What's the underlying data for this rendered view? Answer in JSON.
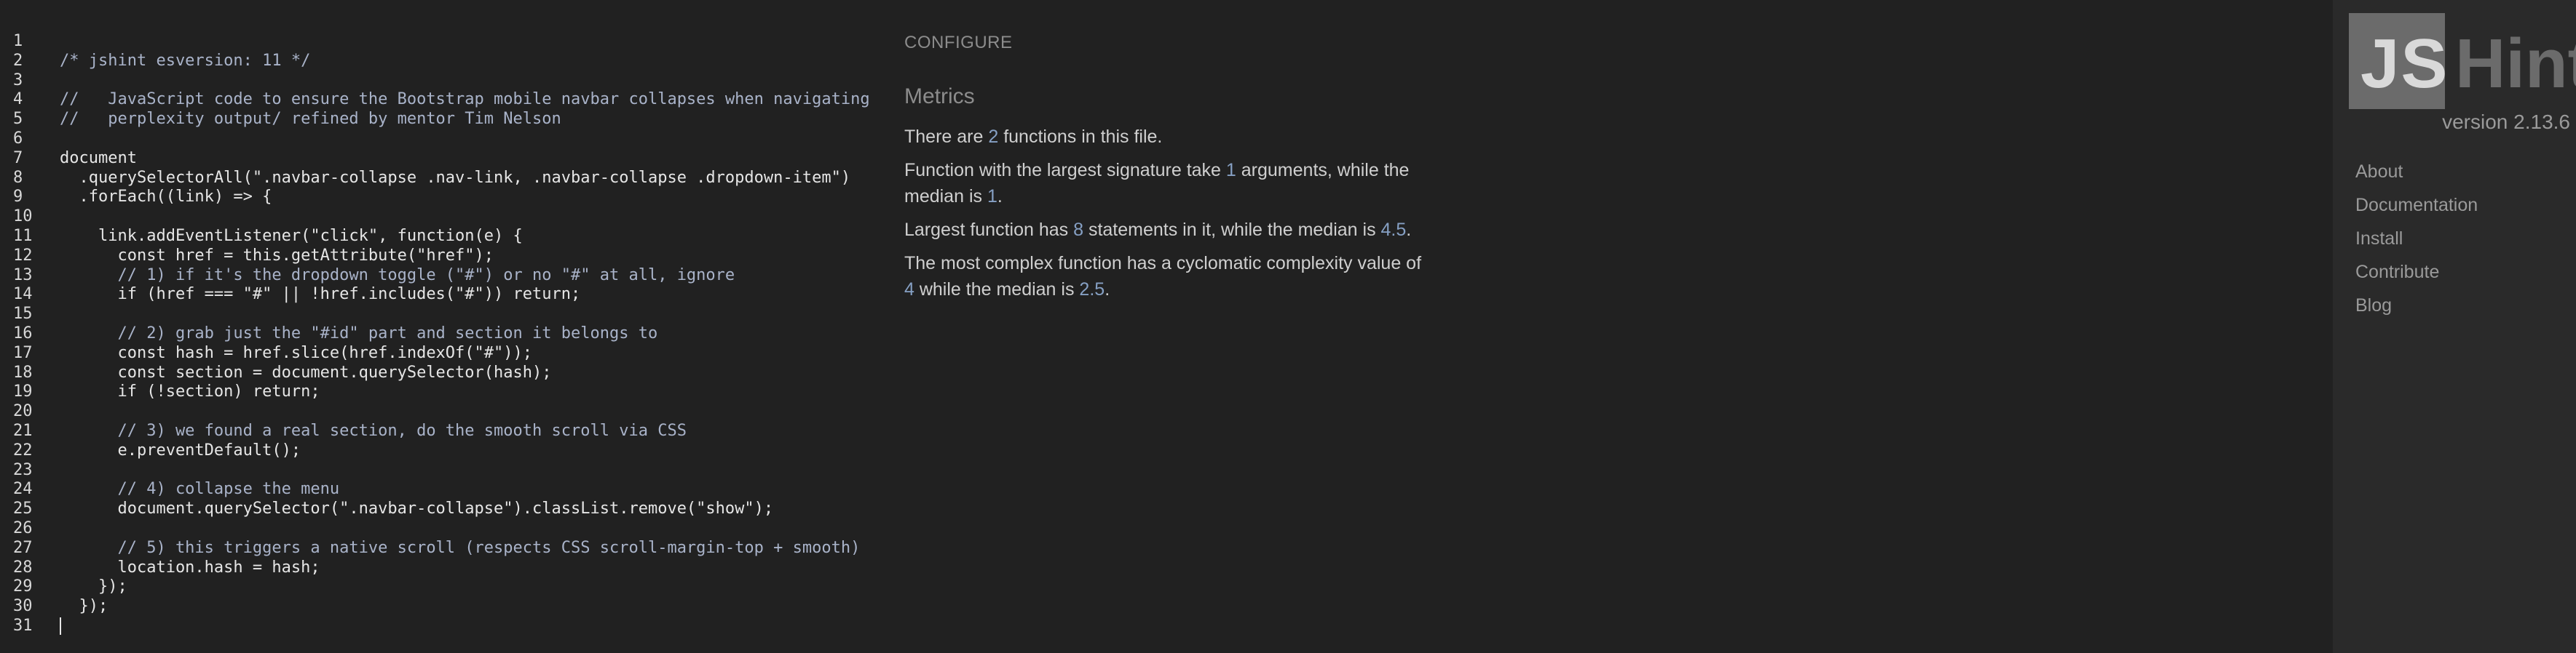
{
  "editor": {
    "line_numbers": [
      "1",
      "2",
      "3",
      "4",
      "5",
      "6",
      "7",
      "8",
      "9",
      "10",
      "11",
      "12",
      "13",
      "14",
      "15",
      "16",
      "17",
      "18",
      "19",
      "20",
      "21",
      "22",
      "23",
      "24",
      "25",
      "26",
      "27",
      "28",
      "29",
      "30",
      "31"
    ],
    "lines": [
      "",
      "/* jshint esversion: 11 */",
      "",
      "//   JavaScript code to ensure the Bootstrap mobile navbar collapses when navigating",
      "//   perplexity output/ refined by mentor Tim Nelson",
      "",
      "document",
      "  .querySelectorAll(\".navbar-collapse .nav-link, .navbar-collapse .dropdown-item\")",
      "  .forEach((link) => {",
      "",
      "    link.addEventListener(\"click\", function(e) {",
      "      const href = this.getAttribute(\"href\");",
      "      // 1) if it's the dropdown toggle (\"#\") or no \"#\" at all, ignore",
      "      if (href === \"#\" || !href.includes(\"#\")) return;",
      "",
      "      // 2) grab just the \"#id\" part and section it belongs to",
      "      const hash = href.slice(href.indexOf(\"#\"));",
      "      const section = document.querySelector(hash);",
      "      if (!section) return;",
      "",
      "      // 3) we found a real section, do the smooth scroll via CSS",
      "      e.preventDefault();",
      "",
      "      // 4) collapse the menu",
      "      document.querySelector(\".navbar-collapse\").classList.remove(\"show\");",
      "",
      "      // 5) this triggers a native scroll (respects CSS scroll-margin-top + smooth)",
      "      location.hash = hash;",
      "    });",
      "  });",
      ""
    ]
  },
  "report": {
    "configure_label": "CONFIGURE",
    "metrics_title": "Metrics",
    "m1_a": "There are ",
    "m1_n": "2",
    "m1_b": " functions in this file.",
    "m2_a": "Function with the largest signature take ",
    "m2_n1": "1",
    "m2_b": " arguments, while the median is ",
    "m2_n2": "1",
    "m2_c": ".",
    "m3_a": "Largest function has ",
    "m3_n1": "8",
    "m3_b": " statements in it, while the median is ",
    "m3_n2": "4.5",
    "m3_c": ".",
    "m4_a": "The most complex function has a cyclomatic complexity value of ",
    "m4_n1": "4",
    "m4_b": " while the median is ",
    "m4_n2": "2.5",
    "m4_c": "."
  },
  "sidebar": {
    "logo_js": "JS",
    "logo_hint": "Hint",
    "version": "version 2.13.6",
    "nav": [
      "About",
      "Documentation",
      "Install",
      "Contribute",
      "Blog"
    ]
  },
  "colors": {
    "background": "#212121",
    "sidebar_bg": "#2a2a2a",
    "number_accent": "#86a0c4"
  }
}
